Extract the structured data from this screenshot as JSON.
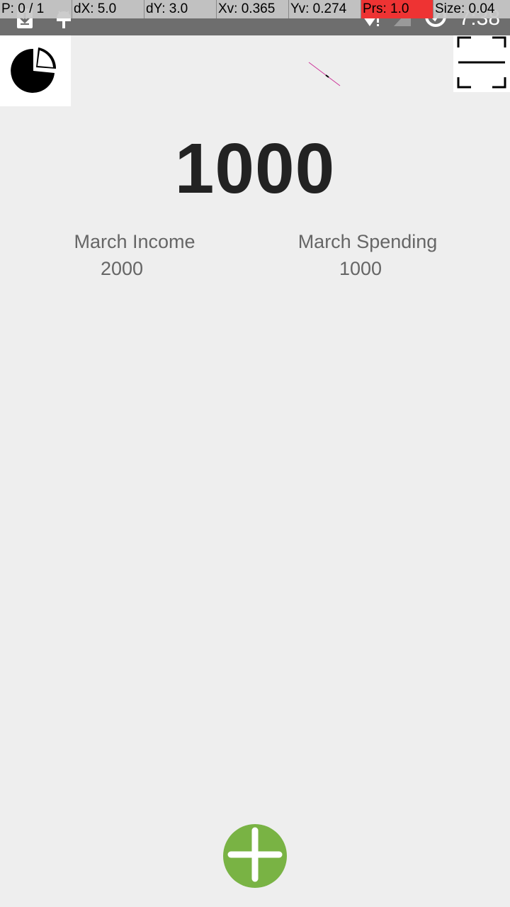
{
  "pointer_overlay": {
    "p": "P: 0 / 1",
    "dx": "dX: 5.0",
    "dy": "dY: 3.0",
    "xv": "Xv: 0.365",
    "yv": "Yv: 0.274",
    "prs": "Prs: 1.0",
    "size": "Size: 0.04"
  },
  "status_bar": {
    "time": "7:38",
    "left_icons": [
      "download-icon",
      "android-icon"
    ],
    "right_icons": [
      "wifi-alert-icon",
      "no-signal-icon",
      "data-saver-icon"
    ]
  },
  "toolbar": {
    "chart_icon": "pie-chart-icon",
    "scan_icon": "scan-icon"
  },
  "summary": {
    "balance": "1000",
    "income_label": "March Income",
    "income_value": "2000",
    "spending_label": "March Spending",
    "spending_value": "1000"
  },
  "fab": {
    "icon": "plus-icon"
  },
  "colors": {
    "status_bar": "#6e6e6e",
    "background": "#eeeeee",
    "fab": "#79b344",
    "balance_text": "#222222",
    "summary_text": "#666666",
    "overlay_prs": "#ee3333"
  }
}
